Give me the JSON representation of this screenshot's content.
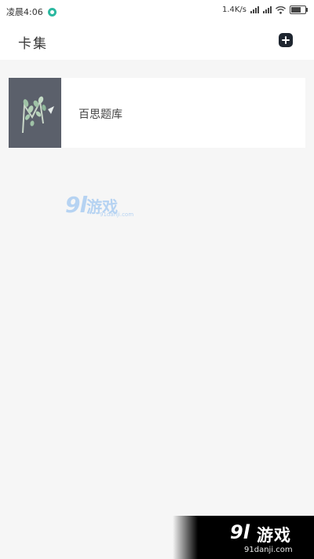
{
  "status_bar": {
    "time": "凌晨4:06",
    "network_speed": "1.4K/s",
    "battery_level": 0.7,
    "accent_color": "#2bb8a0"
  },
  "header": {
    "title": "卡集",
    "add_icon": "plus-icon"
  },
  "cards": [
    {
      "title": "百思题库",
      "cover": "plant-sketch-cover"
    }
  ],
  "watermarks": {
    "center": {
      "logo": "9l",
      "name": "游戏",
      "url": "91danji.com"
    },
    "corner": {
      "logo": "9l",
      "name": "游戏",
      "url": "91danji.com"
    }
  }
}
